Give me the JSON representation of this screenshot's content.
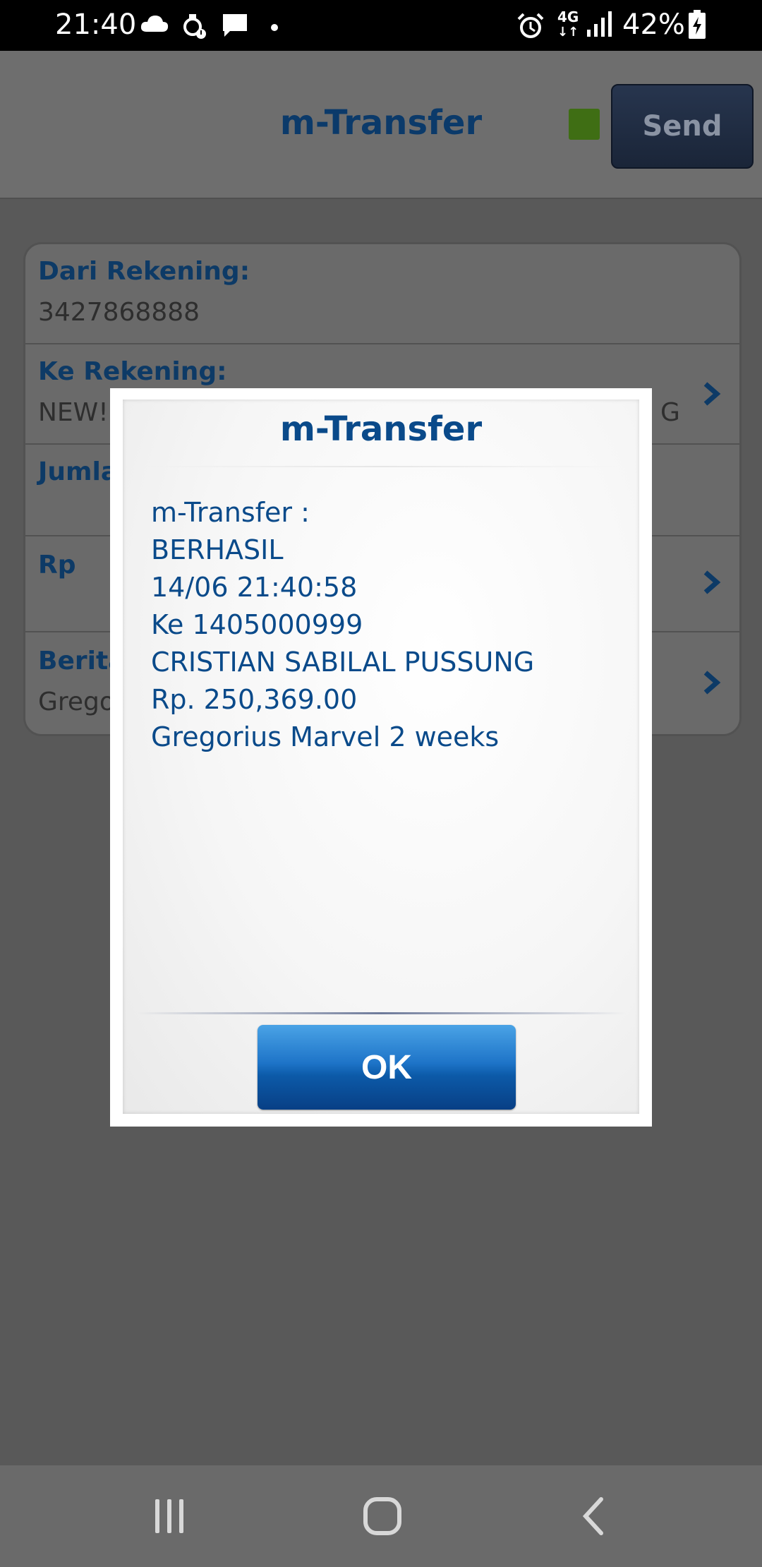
{
  "status_bar": {
    "time": "21:40",
    "network": "4G",
    "battery": "42%",
    "icons": [
      "cloud-icon",
      "watch-alert-icon",
      "message-icon",
      "dot-icon",
      "alarm-icon",
      "signal-icon",
      "battery-charging-icon"
    ]
  },
  "header": {
    "title": "m-Transfer",
    "status_color": "#3f6e14",
    "send_label": "Send"
  },
  "form": {
    "from_label": "Dari Rekening:",
    "from_value": "3427868888",
    "to_label": "Ke Rekening:",
    "to_value_visible": "NEW!",
    "to_value_tail": "G",
    "amount_label_visible": "Jumla",
    "currency_label": "Rp",
    "note_label_visible": "Berita",
    "note_value_visible": "Grego"
  },
  "dialog": {
    "title": "m-Transfer",
    "lines": [
      "m-Transfer :",
      "BERHASIL",
      "14/06 21:40:58",
      "Ke 1405000999",
      "CRISTIAN SABILAL PUSSUNG",
      "Rp. 250,369.00",
      "Gregorius Marvel 2 weeks"
    ],
    "ok_label": "OK"
  },
  "nav": {
    "icons": [
      "recent-apps-icon",
      "home-icon",
      "back-icon"
    ]
  },
  "colors": {
    "accent": "#0a4a8a",
    "ok_button": "#1e74c8"
  }
}
